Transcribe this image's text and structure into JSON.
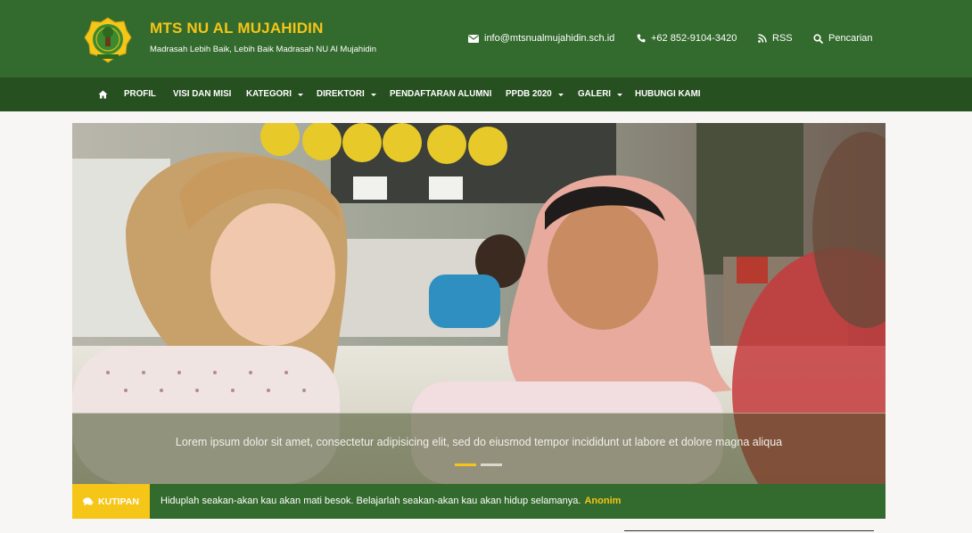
{
  "header": {
    "title": "MTS NU AL MUJAHIDIN",
    "tagline": "Madrasah Lebih Baik, Lebih Baik Madrasah NU Al Mujahidin",
    "logo_icon": "madrasah-emblem-icon",
    "contacts": [
      {
        "icon": "envelope-icon",
        "text": "info@mtsnualmujahidin.sch.id"
      },
      {
        "icon": "phone-icon",
        "text": "+62 852-9104-3420"
      },
      {
        "icon": "rss-icon",
        "text": "RSS"
      },
      {
        "icon": "search-icon",
        "text": "Pencarian"
      }
    ]
  },
  "nav": {
    "home_icon": "home-icon",
    "items": [
      {
        "label": "PROFIL",
        "dropdown": false
      },
      {
        "label": "VISI DAN MISI",
        "dropdown": false
      },
      {
        "label": "KATEGORI",
        "dropdown": true
      },
      {
        "label": "DIREKTORI",
        "dropdown": true
      },
      {
        "label": "PENDAFTARAN ALUMNI",
        "dropdown": false
      },
      {
        "label": "PPDB 2020",
        "dropdown": true
      },
      {
        "label": "GALERI",
        "dropdown": true
      },
      {
        "label": "HUBUNGI KAMI",
        "dropdown": false
      }
    ]
  },
  "slider": {
    "caption": "Lorem ipsum dolor sit amet, consectetur adipisicing elit, sed do eiusmod tempor incididunt ut labore et dolore magna aliqua",
    "slide_count": 2,
    "active_slide": 1
  },
  "quote": {
    "label": "KUTIPAN",
    "text": "Hiduplah seakan-akan kau akan mati besok. Belajarlah seakan-akan kau akan hidup selamanya.",
    "author": "Anonim"
  },
  "colors": {
    "header_green": "#336a2d",
    "nav_green": "#26501f",
    "accent_yellow": "#f5c518",
    "page_bg": "#f7f6f4"
  }
}
